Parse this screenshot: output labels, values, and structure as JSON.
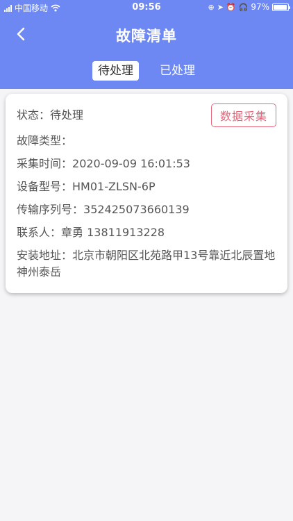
{
  "status_bar": {
    "carrier": "中国移动",
    "time": "09:56",
    "battery": "97%",
    "battery_level": 0.97
  },
  "navbar": {
    "title": "故障清单"
  },
  "tabs": [
    {
      "label": "待处理",
      "active": true
    },
    {
      "label": "已处理",
      "active": false
    }
  ],
  "card": {
    "status_label": "状态：",
    "status_value": "待处理",
    "collect_button": "数据采集",
    "fault_type_label": "故障类型：",
    "fault_type_value": "",
    "collect_time_label": "采集时间：",
    "collect_time_value": "2020-09-09 16:01:53",
    "device_model_label": "设备型号：",
    "device_model_value": "HM01-ZLSN-6P",
    "serial_label": "传输序列号：",
    "serial_value": "352425073660139",
    "contact_label": "联系人：",
    "contact_value": "章勇 13811913228",
    "address_label": "安装地址：",
    "address_value": "北京市朝阳区北苑路甲13号靠近北辰置地神州泰岳"
  },
  "colors": {
    "header": "#6d88f2",
    "accent_red": "#e6657a",
    "background": "#f5f5f7"
  }
}
